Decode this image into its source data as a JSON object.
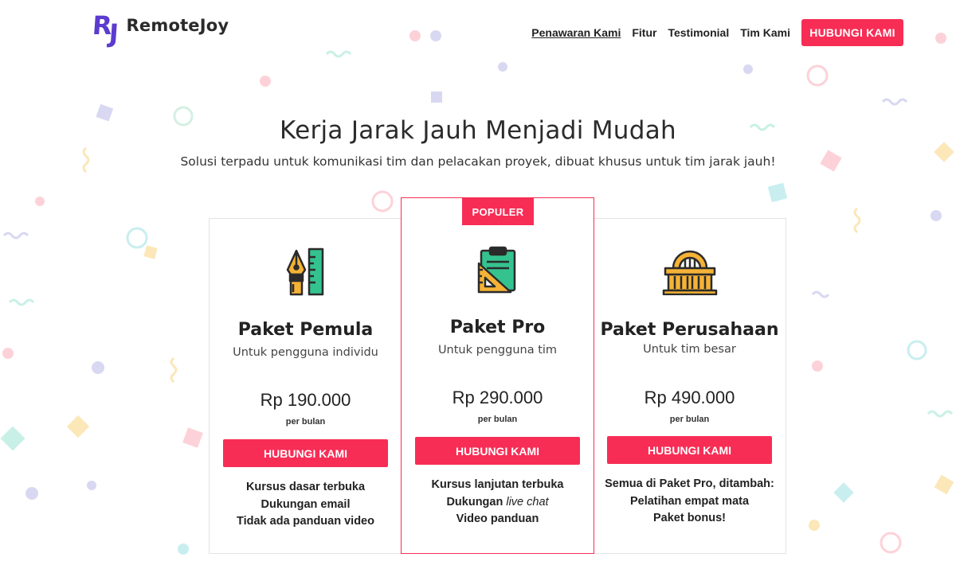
{
  "brand": {
    "mark": "RJ",
    "name": "RemoteJoy"
  },
  "nav": {
    "items": [
      "Penawaran Kami",
      "Fitur",
      "Testimonial",
      "Tim Kami"
    ],
    "cta": "HUBUNGI KAMI"
  },
  "hero": {
    "title": "Kerja Jarak Jauh Menjadi Mudah",
    "subtitle": "Solusi terpadu untuk komunikasi tim dan pelacakan proyek, dibuat khusus untuk tim jarak jauh!"
  },
  "plans": [
    {
      "icon": "pen-ruler-icon",
      "name": "Paket Pemula",
      "audience": "Untuk pengguna individu",
      "price": "Rp 190.000",
      "period": "per bulan",
      "button": "HUBUNGI KAMI",
      "features": [
        "Kursus dasar terbuka",
        "Dukungan email",
        "Tidak ada panduan video"
      ]
    },
    {
      "badge": "POPULER",
      "icon": "clipboard-setsquare-icon",
      "name": "Paket Pro",
      "audience": "Untuk pengguna tim",
      "price": "Rp 290.000",
      "period": "per bulan",
      "button": "HUBUNGI KAMI",
      "features": [
        "Kursus lanjutan terbuka",
        "Dukungan",
        "live chat",
        "Video panduan"
      ]
    },
    {
      "icon": "building-icon",
      "name": "Paket Perusahaan",
      "audience": "Untuk tim besar",
      "price": "Rp 490.000",
      "period": "per bulan",
      "button": "HUBUNGI KAMI",
      "features": [
        "Semua di Paket Pro, ditambah:",
        "Pelatihan empat mata",
        "Paket bonus!"
      ]
    }
  ],
  "colors": {
    "accent": "#f72d55",
    "brand": "#5b3bd0",
    "text": "#222222",
    "border": "#e3e3e3"
  }
}
